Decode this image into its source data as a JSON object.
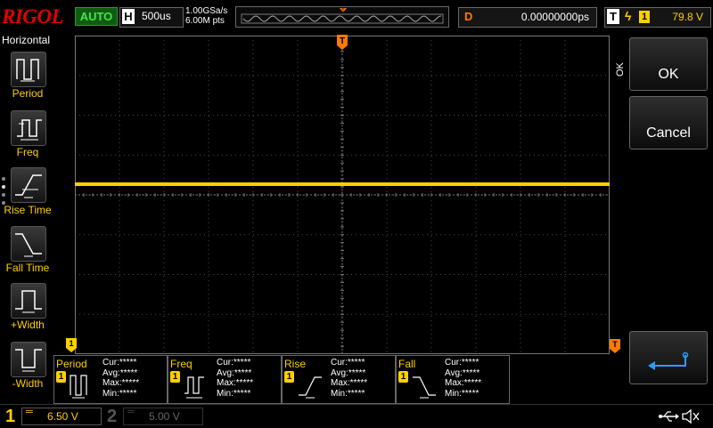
{
  "header": {
    "brand": "RIGOL",
    "run_status": "AUTO",
    "timebase": {
      "letter": "H",
      "scale": "500us"
    },
    "sample_rate": "1.00GSa/s",
    "memory_depth": "6.00M pts",
    "delay": {
      "letter": "D",
      "value": "0.00000000ps"
    },
    "trigger": {
      "letter": "T",
      "source": "1",
      "level": "79.8 V"
    }
  },
  "left_menu": {
    "title": "Horizontal",
    "items": [
      {
        "label": "Period",
        "icon": "period-icon"
      },
      {
        "label": "Freq",
        "icon": "frequency-icon"
      },
      {
        "label": "Rise Time",
        "icon": "rise-time-icon"
      },
      {
        "label": "Fall Time",
        "icon": "fall-time-icon"
      },
      {
        "label": "+Width",
        "icon": "positive-width-icon"
      },
      {
        "label": "-Width",
        "icon": "negative-width-icon"
      }
    ]
  },
  "right_menu": {
    "ok_label": "OK",
    "cancel_label": "Cancel",
    "side_label": "OK",
    "enter_icon": "enter-arrow-icon"
  },
  "measurements": [
    {
      "name": "Period",
      "channel": "1",
      "cur": "Cur:*****",
      "avg": "Avg:*****",
      "max": "Max:*****",
      "min": "Min:*****"
    },
    {
      "name": "Freq",
      "channel": "1",
      "cur": "Cur:*****",
      "avg": "Avg:*****",
      "max": "Max:*****",
      "min": "Min:*****"
    },
    {
      "name": "Rise",
      "channel": "1",
      "cur": "Cur:*****",
      "avg": "Avg:*****",
      "max": "Max:*****",
      "min": "Min:*****"
    },
    {
      "name": "Fall",
      "channel": "1",
      "cur": "Cur:*****",
      "avg": "Avg:*****",
      "max": "Max:*****",
      "min": "Min:*****"
    }
  ],
  "channels": [
    {
      "number": "1",
      "scale": "6.50 V",
      "active": true,
      "color": "#ffd000"
    },
    {
      "number": "2",
      "scale": "5.00 V",
      "active": false,
      "color": "#555555"
    }
  ],
  "status_icons": [
    "usb-icon",
    "speaker-muted-icon"
  ],
  "colors": {
    "ch1": "#ffd000",
    "trigger": "#ff8c00",
    "run_status": "#49e04f",
    "brand": "#e00000"
  }
}
